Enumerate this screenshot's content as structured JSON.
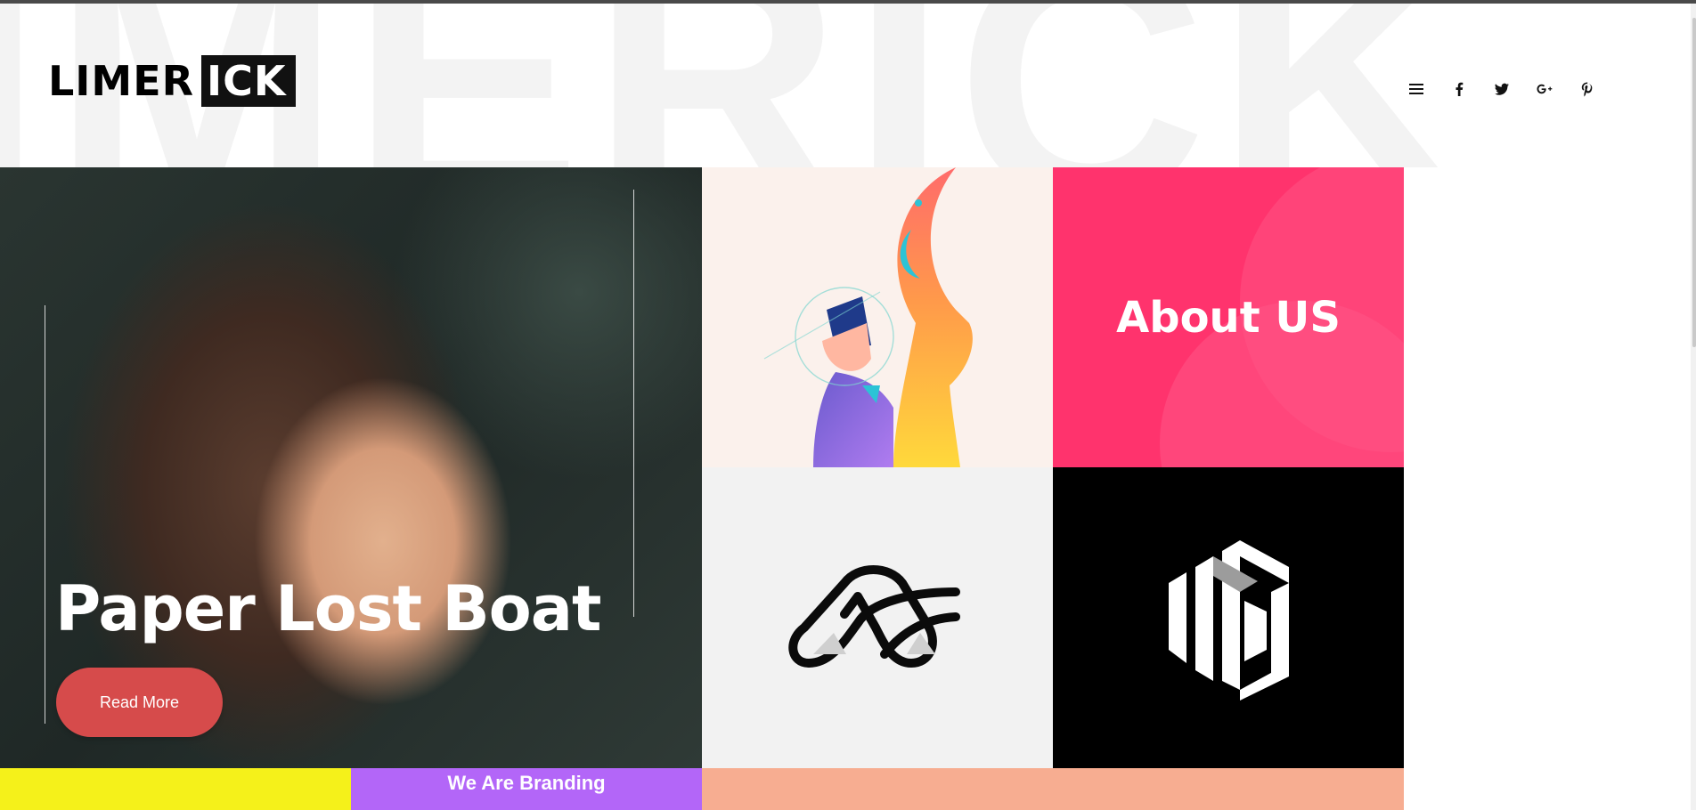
{
  "header": {
    "background_word": "IMERICK",
    "logo": {
      "part1": "LIMER",
      "part2": "ICK"
    },
    "icons": [
      "menu-icon",
      "facebook-icon",
      "twitter-icon",
      "google-plus-icon",
      "pinterest-icon"
    ]
  },
  "hero": {
    "title": "Paper Lost Boat",
    "button_label": "Read More",
    "button_color": "#d64b4b"
  },
  "tiles": {
    "about_title": "About US",
    "about_color": "#ff336d",
    "logo2_bg": "#000000"
  },
  "bottom": {
    "purple_title": "We Are Branding",
    "yellow_color": "#f5f11a",
    "purple_color": "#b366f8",
    "peach_color": "#f7ad91"
  }
}
